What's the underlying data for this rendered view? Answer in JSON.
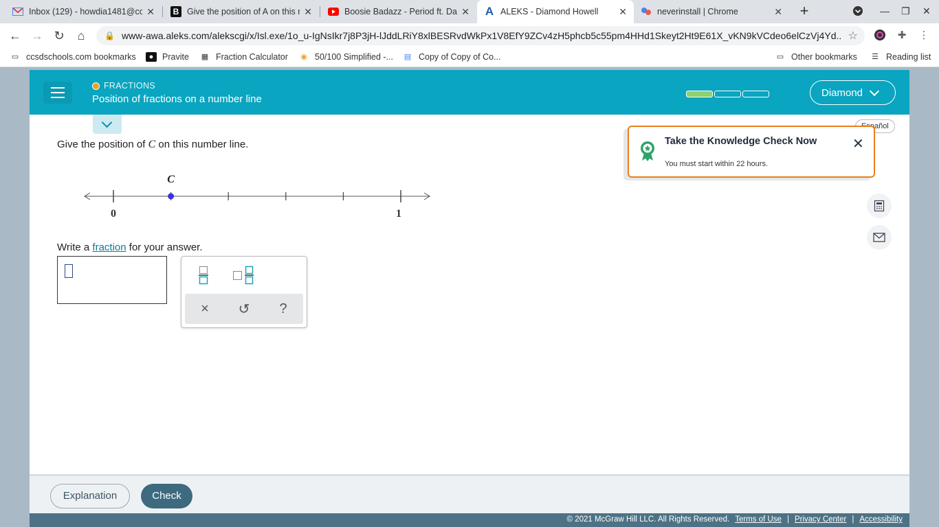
{
  "browser": {
    "tabs": [
      {
        "title": "Inbox (129) - howdia1481@cc",
        "favicon": "gmail-icon"
      },
      {
        "title": "Give the position of A on this n",
        "favicon": "b-icon"
      },
      {
        "title": "Boosie Badazz - Period ft. DaB",
        "favicon": "youtube-icon"
      },
      {
        "title": "ALEKS - Diamond Howell",
        "favicon": "aleks-icon",
        "active": true
      },
      {
        "title": "neverinstall | Chrome",
        "favicon": "neverinstall-icon"
      }
    ],
    "url": "www-awa.aleks.com/alekscgi/x/Isl.exe/1o_u-IgNsIkr7j8P3jH-lJddLRiY8xlBESRvdWkPx1V8EfY9ZCv4zH5phcb5c55pm4HHd1Skeyt2Ht9E61X_vKN9kVCdeo6elCzVj4Yd...",
    "bookmarks": [
      {
        "label": "ccsdschools.com bookmarks",
        "icon": "folder-icon"
      },
      {
        "label": "Pravite",
        "icon": "pravite-icon"
      },
      {
        "label": "Fraction Calculator",
        "icon": "calculator-icon"
      },
      {
        "label": "50/100 Simplified -...",
        "icon": "lightbulb-icon"
      },
      {
        "label": "Copy of Copy of Co...",
        "icon": "docs-icon"
      }
    ],
    "other_bookmarks": "Other bookmarks",
    "reading_list": "Reading list"
  },
  "aleks": {
    "topic": "FRACTIONS",
    "lesson_title": "Position of fractions on a number line",
    "progress": {
      "segments": 3,
      "filled": 1
    },
    "user": "Diamond",
    "question_prefix": "Give the position of ",
    "question_var": "C",
    "question_suffix": " on this number line.",
    "numberline": {
      "start_label": "0",
      "end_label": "1",
      "divisions": 5,
      "point_label": "C",
      "point_value": 0.2,
      "point_color": "#3535e0"
    },
    "write_prefix": "Write a ",
    "write_link": "fraction",
    "write_suffix": " for your answer.",
    "keypad": {
      "fraction": "fraction-icon",
      "mixed_number": "mixed-number-icon",
      "clear": "×",
      "undo": "↺",
      "help": "?"
    },
    "knowledge_check": {
      "title": "Take the Knowledge Check Now",
      "subtitle": "You must start within 22 hours."
    },
    "espanol": "Español",
    "buttons": {
      "explanation": "Explanation",
      "check": "Check"
    },
    "footer": {
      "copyright": "© 2021 McGraw Hill LLC. All Rights Reserved.",
      "terms": "Terms of Use",
      "privacy": "Privacy Center",
      "accessibility": "Accessibility"
    },
    "colors": {
      "header": "#0aa5c0",
      "accent_orange": "#ea7d1c",
      "check_button": "#3d6a7e"
    }
  }
}
